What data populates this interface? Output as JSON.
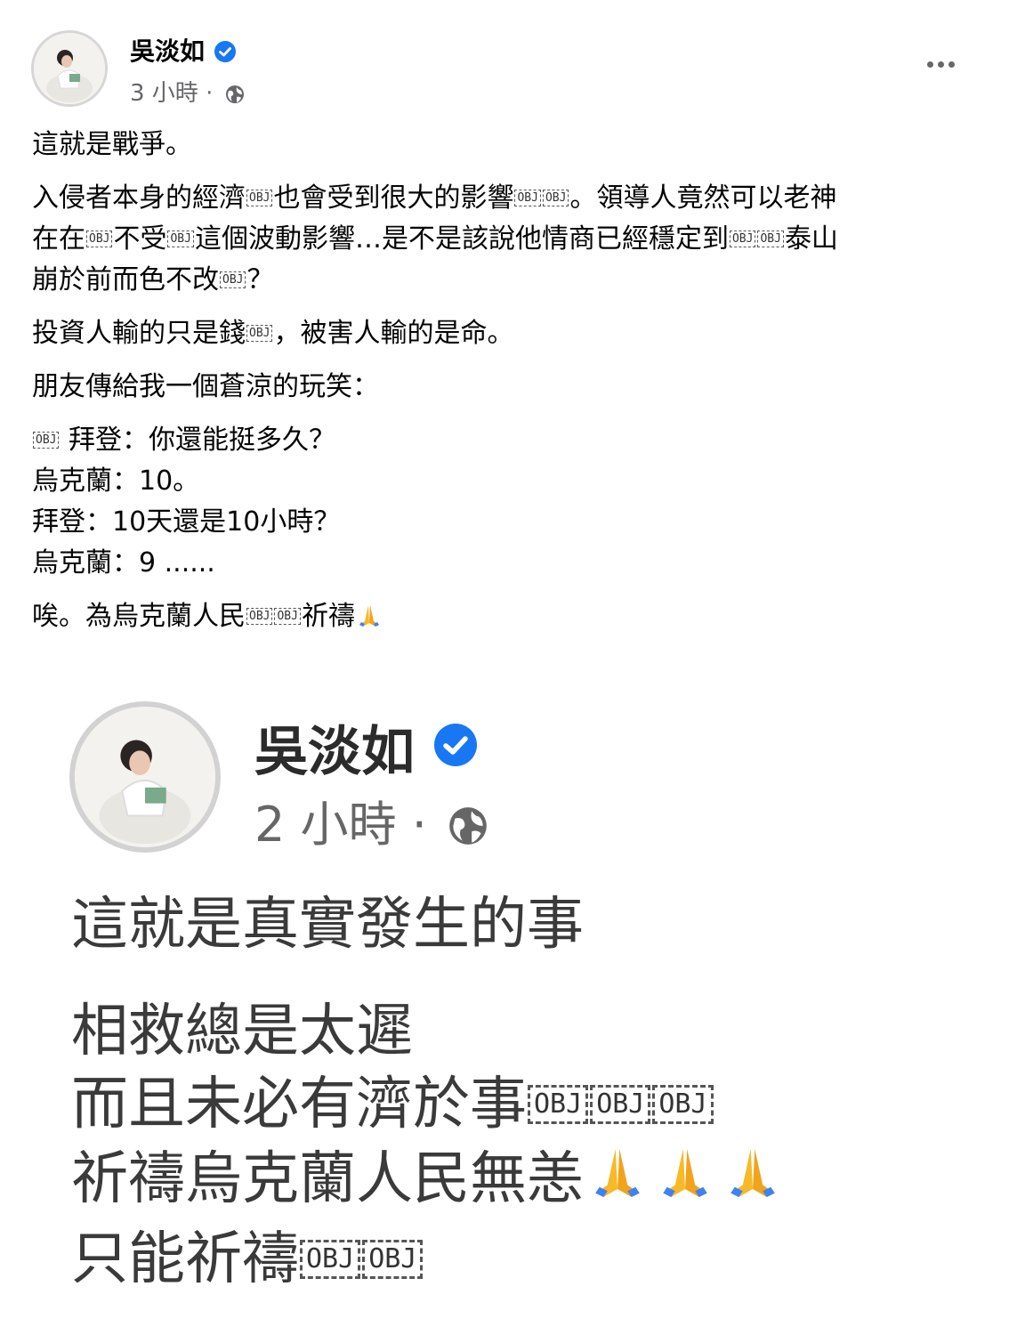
{
  "post": {
    "author": "吳淡如",
    "time": "3 小時",
    "separator": "·",
    "body": {
      "p1": "這就是戰爭。",
      "p2_a": "入侵者本身的經濟",
      "p2_b": "也會受到很大的影響",
      "p2_c": "。領導人竟然可以老神",
      "p2_d": "在在",
      "p2_e": "不受",
      "p2_f": "這個波動影響…是不是該說他情商已經穩定到",
      "p2_g": "泰山",
      "p2_h": "崩於前而色不改",
      "p2_i": "？",
      "p3_a": "投資人輸的只是錢",
      "p3_b": "，被害人輸的是命。",
      "p4": "朋友傳給我一個蒼涼的玩笑：",
      "joke_1": " 拜登：你還能挺多久？",
      "joke_2": "烏克蘭：10。",
      "joke_3": "拜登：10天還是10小時？",
      "joke_4": "烏克蘭：9 ......",
      "p6_a": "唉。為烏克蘭人民",
      "p6_b": "祈禱"
    },
    "obj_label": "OBJ"
  },
  "embedded": {
    "author": "吳淡如",
    "time": "2 小時",
    "separator": "·",
    "line1": "這就是真實發生的事",
    "line2": "相救總是太遲",
    "line3": "而且未必有濟於事",
    "line4": "祈禱烏克蘭人民無恙",
    "line5": "只能祈禱"
  },
  "icons": {
    "verified": "verified-badge-icon",
    "globe": "globe-icon",
    "more": "more-options-icon",
    "pray": "folded-hands-emoji"
  },
  "colors": {
    "verified_blue": "#1877f2",
    "meta_gray": "#65676b",
    "pray_yellow": "#f7b928",
    "pray_blue": "#3b82f6"
  }
}
